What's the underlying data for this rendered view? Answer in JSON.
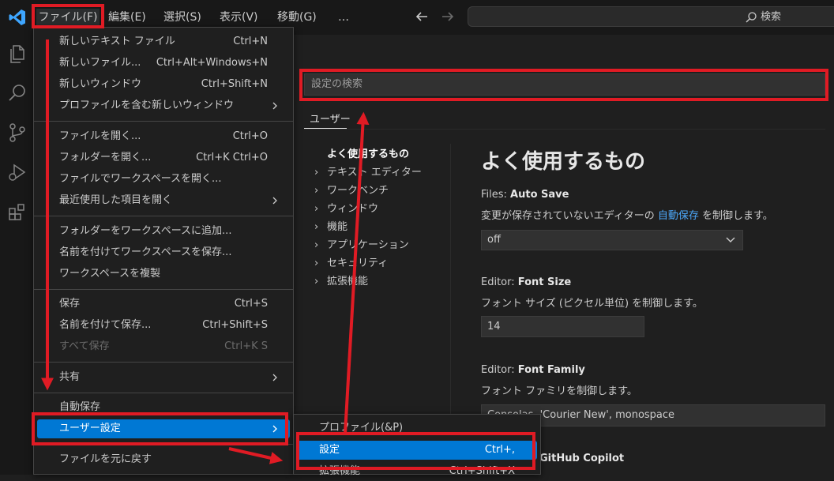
{
  "titlebar": {
    "menus": [
      "ファイル(F)",
      "編集(E)",
      "選択(S)",
      "表示(V)",
      "移動(G)",
      "…"
    ],
    "search_label": "検索"
  },
  "activity_icons": [
    "explorer-icon",
    "search-icon",
    "source-control-icon",
    "run-debug-icon",
    "extensions-icon"
  ],
  "file_menu": {
    "items": [
      {
        "label": "新しいテキスト ファイル",
        "shortcut": "Ctrl+N"
      },
      {
        "label": "新しいファイル...",
        "shortcut": "Ctrl+Alt+Windows+N"
      },
      {
        "label": "新しいウィンドウ",
        "shortcut": "Ctrl+Shift+N"
      },
      {
        "label": "プロファイルを含む新しいウィンドウ",
        "shortcut": ""
      },
      {
        "label": "ファイルを開く...",
        "shortcut": "Ctrl+O"
      },
      {
        "label": "フォルダーを開く...",
        "shortcut": "Ctrl+K Ctrl+O"
      },
      {
        "label": "ファイルでワークスペースを開く...",
        "shortcut": ""
      },
      {
        "label": "最近使用した項目を開く",
        "shortcut": ""
      },
      {
        "label": "フォルダーをワークスペースに追加...",
        "shortcut": ""
      },
      {
        "label": "名前を付けてワークスペースを保存...",
        "shortcut": ""
      },
      {
        "label": "ワークスペースを複製",
        "shortcut": ""
      },
      {
        "label": "保存",
        "shortcut": "Ctrl+S"
      },
      {
        "label": "名前を付けて保存...",
        "shortcut": "Ctrl+Shift+S"
      },
      {
        "label": "すべて保存",
        "shortcut": "Ctrl+K S"
      },
      {
        "label": "共有",
        "shortcut": ""
      },
      {
        "label": "自動保存",
        "shortcut": ""
      },
      {
        "label": "ユーザー設定",
        "shortcut": ""
      },
      {
        "label": "ファイルを元に戻す",
        "shortcut": ""
      }
    ]
  },
  "sub_menu": {
    "items": [
      {
        "label": "プロファイル(&P)",
        "shortcut": ""
      },
      {
        "label": "設定",
        "shortcut": "Ctrl+,"
      },
      {
        "label": "拡張機能",
        "shortcut": "Ctrl+Shift+X"
      }
    ]
  },
  "settings": {
    "search_placeholder": "設定の検索",
    "tab_user": "ユーザー",
    "toc": [
      "よく使用するもの",
      "テキスト エディター",
      "ワークベンチ",
      "ウィンドウ",
      "機能",
      "アプリケーション",
      "セキュリティ",
      "拡張機能"
    ],
    "section_title": "よく使用するもの",
    "autosave": {
      "category": "Files: ",
      "name": "Auto Save",
      "desc_before": "変更が保存されていないエディターの ",
      "desc_link": "自動保存",
      "desc_after": " を制御します。",
      "value": "off"
    },
    "fontsize": {
      "category": "Editor: ",
      "name": "Font Size",
      "desc": "フォント サイズ (ピクセル単位) を制御します。",
      "value": "14"
    },
    "fontfamily": {
      "category": "Editor: ",
      "name": "Font Family",
      "desc": "フォント ファミリを制御します。",
      "value": "Consolas, 'Courier New', monospace"
    },
    "next_title": "GitHub Copilot"
  },
  "colors": {
    "accent": "#0078d4",
    "annotation_red": "#e01b24",
    "link": "#4daafc"
  }
}
